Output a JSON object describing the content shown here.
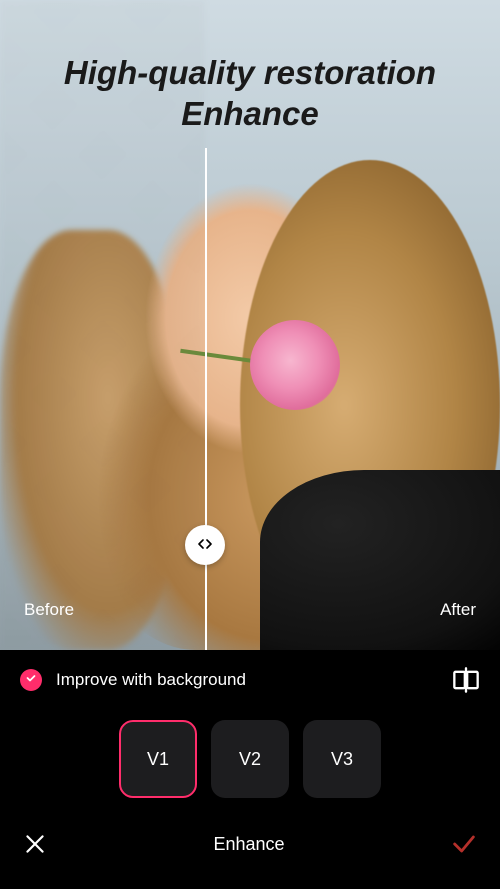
{
  "heading_line1": "High-quality restoration",
  "heading_line2": "Enhance",
  "compare": {
    "before_label": "Before",
    "after_label": "After",
    "slider_icon": "resize-horizontal-icon"
  },
  "toggle": {
    "checked": true,
    "label": "Improve with background"
  },
  "versions": {
    "options": [
      {
        "label": "V1",
        "active": true
      },
      {
        "label": "V2",
        "active": false
      },
      {
        "label": "V3",
        "active": false
      }
    ]
  },
  "bottom": {
    "title": "Enhance"
  },
  "colors": {
    "accent": "#ff2d6b",
    "confirm": "#b5302b"
  }
}
